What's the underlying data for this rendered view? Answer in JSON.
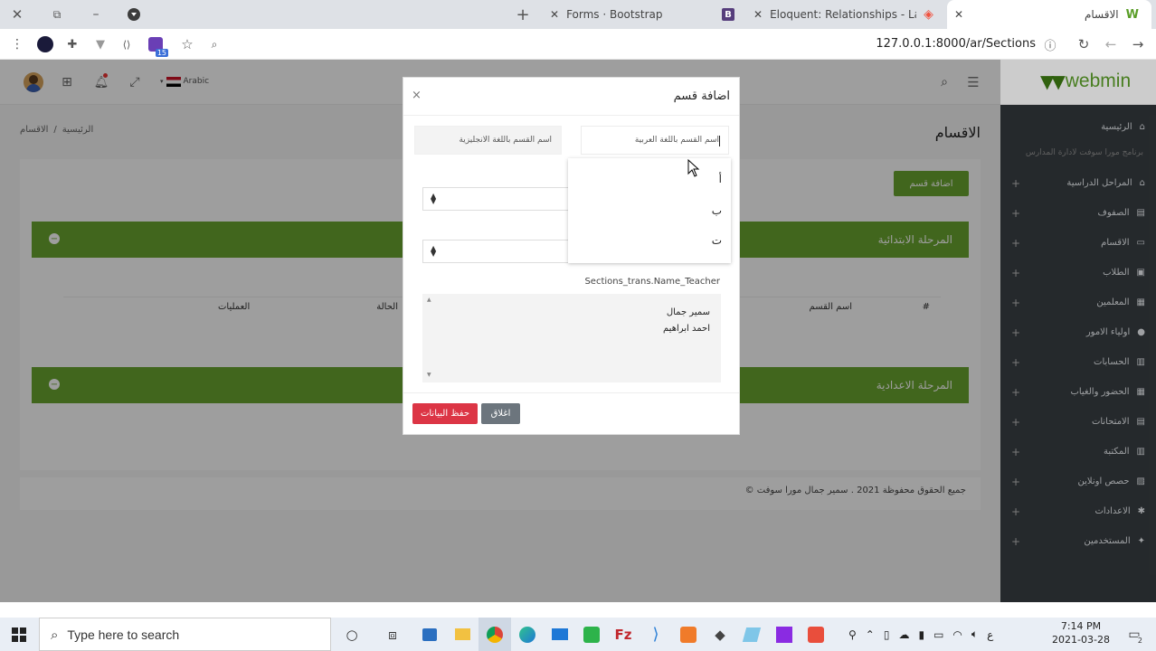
{
  "browser": {
    "tabs": [
      {
        "title": "الاقسام"
      },
      {
        "title": "Eloquent: Relationships - Laravel"
      },
      {
        "title": "Forms · Bootstrap"
      }
    ],
    "url": "127.0.0.1:8000/ar/Sections",
    "extension_badge": "15"
  },
  "header": {
    "logo": "webmin",
    "language": "Arabic"
  },
  "sidebar": {
    "home": "الرئيسية",
    "tagline": "برنامج مورا سوفت لادارة المدارس",
    "items": [
      "المراحل الدراسية",
      "الصفوف",
      "الاقسام",
      "الطلاب",
      "المعلمين",
      "اولياء الامور",
      "الحسابات",
      "الحضور والغياب",
      "الامتحانات",
      "المكتبة",
      "حصص اونلاين",
      "الاعدادات",
      "المستخدمين"
    ]
  },
  "page": {
    "title": "الاقسام",
    "breadcrumb": [
      "الرئيسية",
      "الاقسام"
    ],
    "breadcrumb_sep": "/",
    "add_button": "اضافة قسم",
    "stages": [
      "المرحلة الابتدائية",
      "المرحلة الاعدادية"
    ],
    "table_headers": [
      "#",
      "اسم القسم",
      "الحالة",
      "العمليات"
    ],
    "footer": "© جميع الحقوق محفوظة 2021 . سمير جمال مورا سوفت"
  },
  "modal": {
    "title": "اضافة قسم",
    "close": "×",
    "name_ar_placeholder": "اسم القسم باللغة العربية",
    "name_en_placeholder": "اسم القسم باللغة الانجليزية",
    "suggestions": [
      "أ",
      "ب",
      "ت"
    ],
    "teachers_label": "Sections_trans.Name_Teacher",
    "teachers": [
      "سمير جمال",
      "احمد ابراهيم"
    ],
    "save_button": "حفظ البيانات",
    "close_button": "اغلاق"
  },
  "taskbar": {
    "search_placeholder": "Type here to search",
    "time": "7:14 PM",
    "date": "2021-03-28",
    "lang": "ع",
    "notif_count": "2"
  },
  "colors": {
    "green": "#6aa530",
    "sidebar": "#2f3438",
    "save": "#dc3545",
    "close": "#6c757d"
  }
}
